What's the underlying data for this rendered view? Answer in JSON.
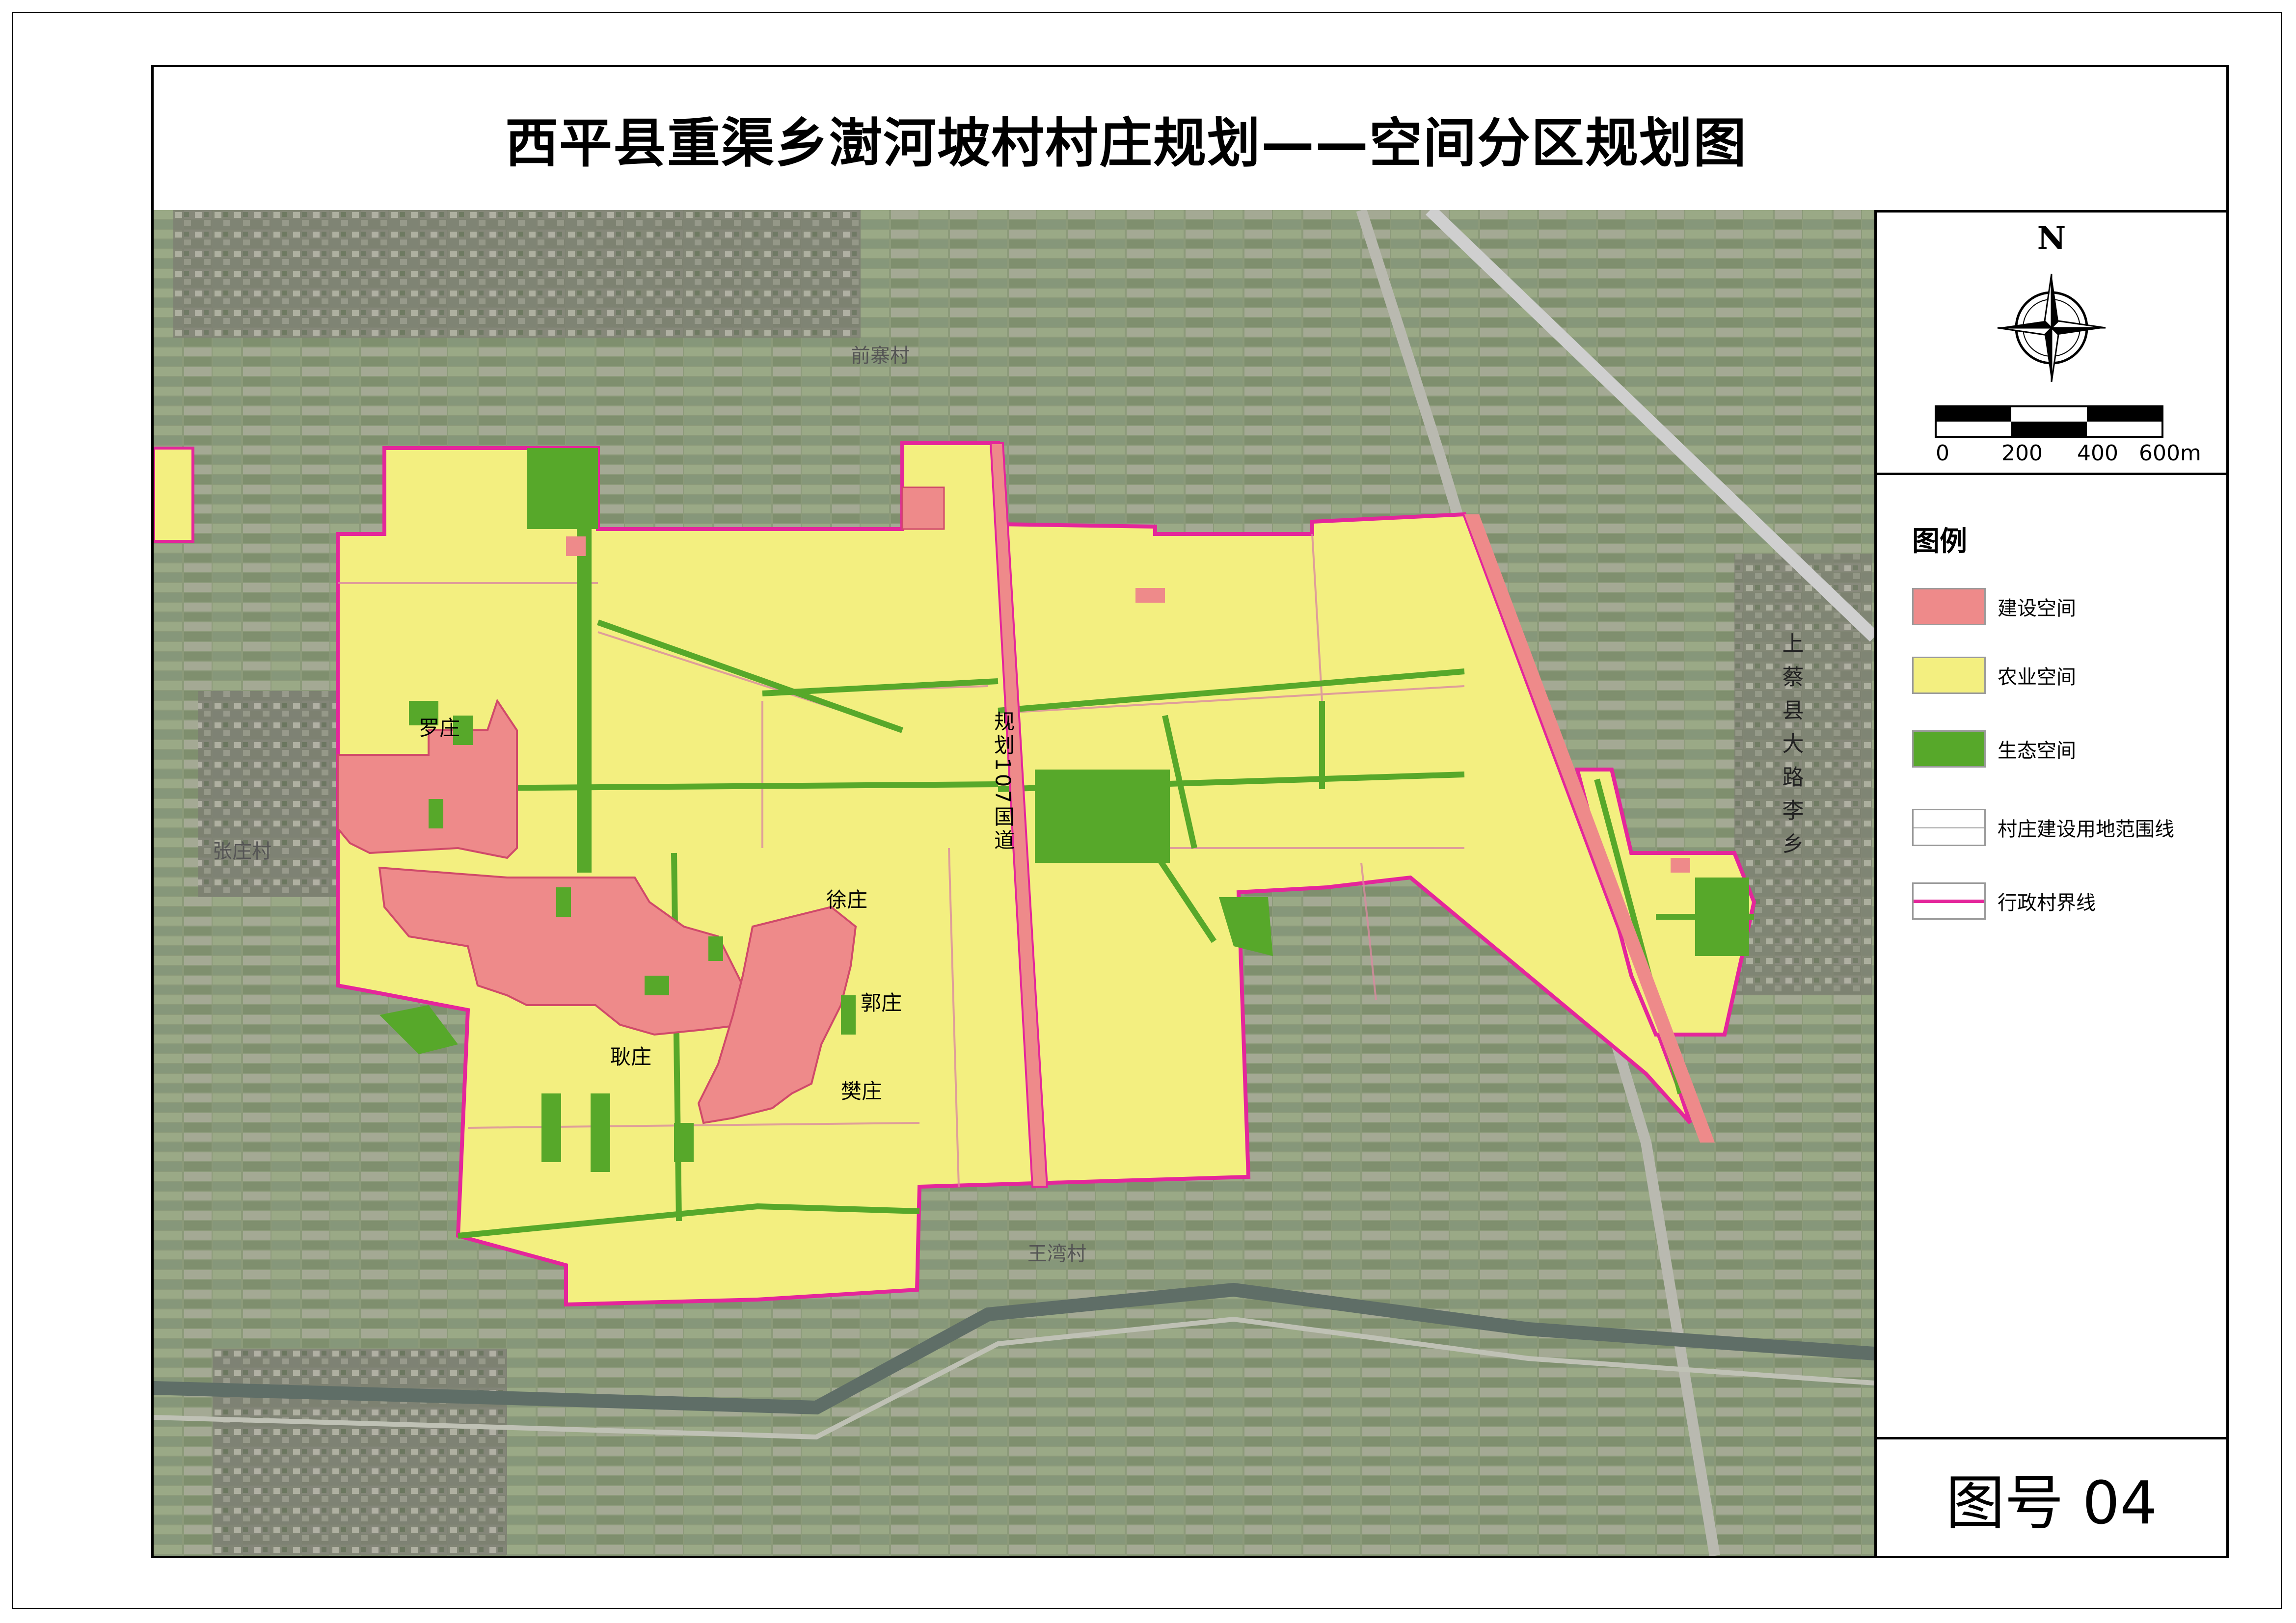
{
  "title": "西平县重渠乡澍河坡村村庄规划——空间分区规划图",
  "north_arrow": {
    "label": "N"
  },
  "scale_bar": {
    "labels": [
      "0",
      "200",
      "400",
      "600m"
    ]
  },
  "legend": {
    "title": "图例",
    "items": [
      {
        "label": "建设空间",
        "color": "#ee8a8a"
      },
      {
        "label": "农业空间",
        "color": "#f3ef80"
      },
      {
        "label": "生态空间",
        "color": "#57a82a"
      },
      {
        "label": "村庄建设用地范围线",
        "color": "#bbbbbb"
      },
      {
        "label": "行政村界线",
        "color": "#e4269b"
      }
    ]
  },
  "figure_number": "图号 04",
  "map_labels": {
    "qianzhai": "前寨村",
    "zhangzhuang": "张庄村",
    "wangwan": "王湾村",
    "shangcai": "上蔡县大路李乡",
    "luozhuang": "罗庄",
    "xuzhuang": "徐庄",
    "guozhuang": "郭庄",
    "gengzhuang": "耿庄",
    "fanzhuang": "樊庄",
    "road107": "规划107国道"
  },
  "colors": {
    "construction": "#ee8a8a",
    "agriculture": "#f3ef80",
    "ecology": "#57a82a",
    "boundary": "#e4269b"
  }
}
